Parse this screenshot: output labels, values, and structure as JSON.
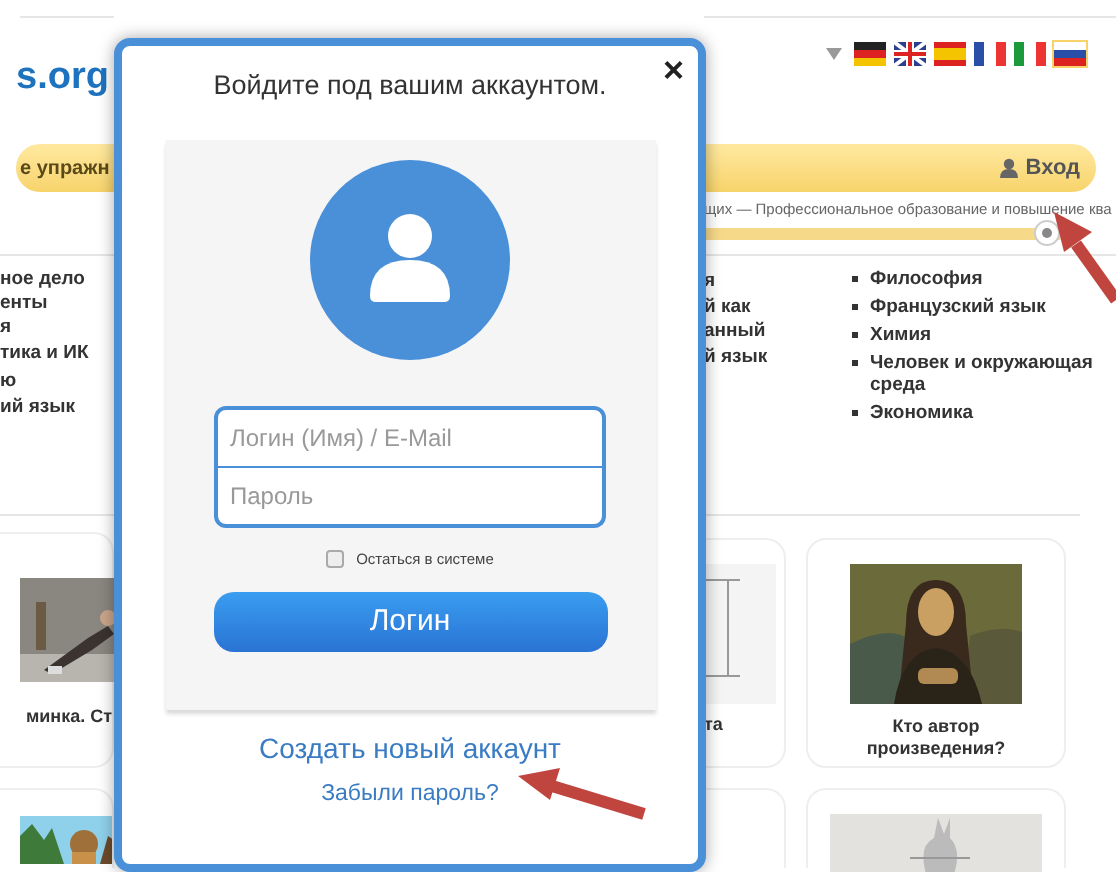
{
  "site": {
    "logo": "s.org",
    "nav_label": "е упражн",
    "login_link": "Вход",
    "tagline": "щих — Профессиональное образование и повышение ква",
    "progress": {
      "level": 0.96
    },
    "languages": [
      {
        "kind": "de",
        "selected": false
      },
      {
        "kind": "gb",
        "selected": false
      },
      {
        "kind": "es",
        "selected": false
      },
      {
        "kind": "fr",
        "selected": false
      },
      {
        "kind": "it",
        "selected": false
      },
      {
        "kind": "ru",
        "selected": true
      }
    ]
  },
  "subjects_left": [
    "ное дело",
    "енты",
    "я",
    "тика и ИК",
    "ю",
    "ий язык"
  ],
  "subjects_middle": [
    "я",
    "й как",
    "анный",
    "й язык"
  ],
  "subjects_right": [
    "Философия",
    "Французский язык",
    "Химия",
    "Человек и окружающая среда",
    "Экономика"
  ],
  "cards": [
    {
      "caption": "минка. Ст"
    },
    {
      "caption": "та"
    },
    {
      "caption": "Кто автор произведения?"
    }
  ],
  "modal": {
    "title": "Войдите под вашим аккаунтом.",
    "close": "×",
    "login_placeholder": "Логин (Имя) / E-Mail",
    "password_placeholder": "Пароль",
    "remember": {
      "label": "Остаться в системе",
      "checked": false
    },
    "submit": "Логин",
    "register_link": "Создать новый аккаунт",
    "forgot_link": "Забыли пароль?"
  }
}
